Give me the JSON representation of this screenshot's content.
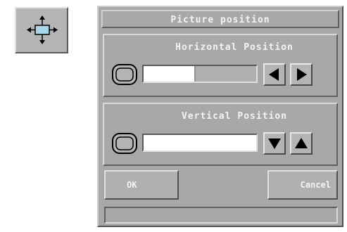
{
  "launcher": {
    "icon": "move-position-icon"
  },
  "dialog": {
    "title": "Picture position",
    "horizontal": {
      "label": "Horizontal Position",
      "level": 0.45,
      "decrease_icon": "arrow-left-icon",
      "increase_icon": "arrow-right-icon"
    },
    "vertical": {
      "label": "Vertical Position",
      "level": 1.0,
      "decrease_icon": "arrow-down-icon",
      "increase_icon": "arrow-up-icon"
    },
    "ok_label": "OK",
    "cancel_label": "Cancel",
    "status_text": ""
  },
  "colors": {
    "face": "#a8a8a8",
    "highlight": "#d8d8d8",
    "shadow": "#606060",
    "label_text": "#f4f4f4",
    "arrow_fill": "#000000"
  }
}
